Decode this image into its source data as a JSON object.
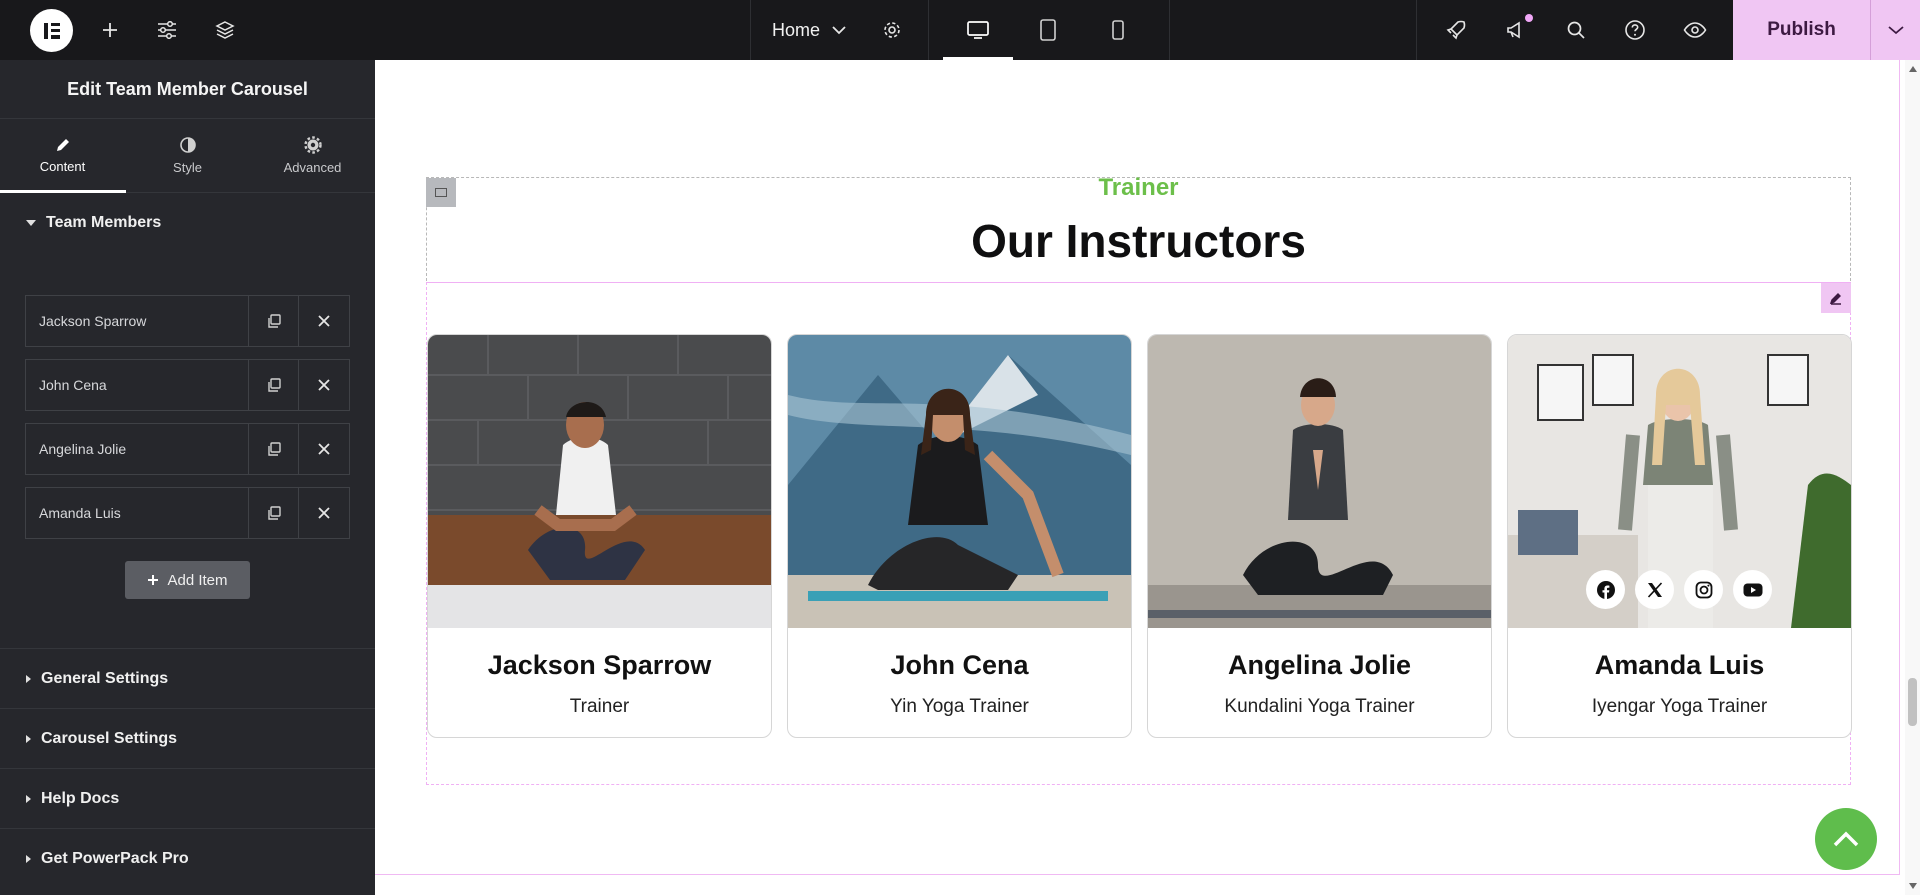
{
  "topbar": {
    "page_name": "Home",
    "publish_label": "Publish",
    "icons": [
      "elementor-logo-icon",
      "add-icon",
      "site-settings-sliders-icon",
      "structure-layers-icon",
      "chevron-down-icon",
      "page-settings-gear-icon",
      "desktop-icon",
      "tablet-icon",
      "mobile-icon",
      "launchpad-rocket-icon",
      "whats-new-megaphone-icon",
      "search-icon",
      "help-icon",
      "preview-eye-icon"
    ]
  },
  "panel": {
    "title": "Edit Team Member Carousel",
    "tabs": [
      {
        "label": "Content",
        "icon": "pencil-icon",
        "active": true
      },
      {
        "label": "Style",
        "icon": "contrast-icon",
        "active": false
      },
      {
        "label": "Advanced",
        "icon": "gear-icon",
        "active": false
      }
    ],
    "team_section_title": "Team Members",
    "members": [
      {
        "label": "Jackson Sparrow"
      },
      {
        "label": "John Cena"
      },
      {
        "label": "Angelina Jolie"
      },
      {
        "label": "Amanda Luis"
      }
    ],
    "add_item_label": "Add Item",
    "sections": [
      {
        "label": "General Settings"
      },
      {
        "label": "Carousel Settings"
      },
      {
        "label": "Help Docs"
      },
      {
        "label": "Get PowerPack Pro"
      }
    ]
  },
  "canvas": {
    "subtitle": "Trainer",
    "title": "Our Instructors",
    "cards": [
      {
        "name": "Jackson Sparrow",
        "role": "Trainer"
      },
      {
        "name": "John Cena",
        "role": "Yin Yoga Trainer"
      },
      {
        "name": "Angelina Jolie",
        "role": "Kundalini Yoga Trainer"
      },
      {
        "name": "Amanda Luis",
        "role": "Iyengar Yoga Trainer"
      }
    ],
    "social_icons": [
      "facebook-icon",
      "x-twitter-icon",
      "instagram-icon",
      "youtube-icon"
    ]
  },
  "colors": {
    "accent_pink": "#f0c6f3",
    "subtitle_green": "#6cbf4a",
    "back_to_top_green": "#5fbd4c",
    "panel_bg": "#26272c",
    "topbar_bg": "#18181b"
  }
}
